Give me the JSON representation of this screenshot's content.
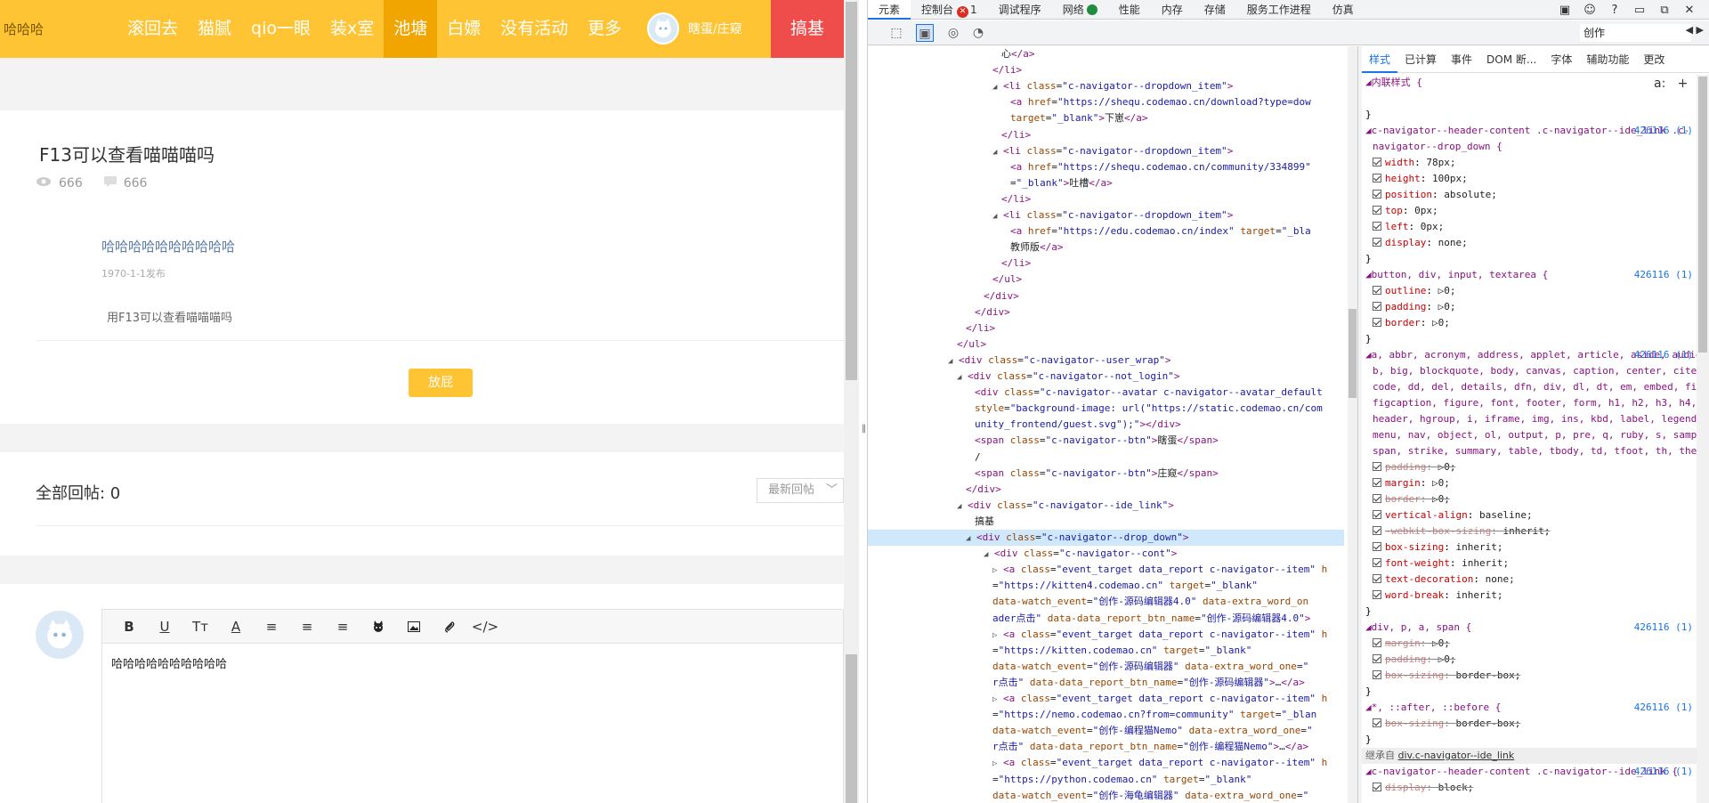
{
  "site": {
    "logo": "哈哈哈",
    "nav": [
      "滚回去",
      "猫腻",
      "qio一眼",
      "装x室",
      "池塘",
      "白嫖",
      "没有活动",
      "更多"
    ],
    "nav_active_index": 4,
    "user_text": "瞎蛋/庄窥",
    "ide_btn": "搞基",
    "accent_color": "#fec433",
    "ide_color": "#ef4c4c"
  },
  "post": {
    "title": "F13可以查看喵喵喵吗",
    "views": "666",
    "comments": "666",
    "reply_user": "哈哈哈哈哈哈哈哈哈哈",
    "reply_date": "1970-1-1发布",
    "reply_content": "用F13可以查看喵喵喵吗",
    "fart_btn": "放屁"
  },
  "replies": {
    "header": "全部回帖: 0",
    "sort": "最新回帖"
  },
  "editor": {
    "toolbar": [
      "B",
      "U",
      "Tт",
      "A",
      "≡",
      "≡",
      "≡",
      "cat",
      "image",
      "attach",
      "</>"
    ],
    "content": "哈哈哈哈哈哈哈哈哈哈"
  },
  "devtools": {
    "tabs": [
      "元素",
      "控制台",
      "调试程序",
      "网络",
      "性能",
      "内存",
      "存储",
      "服务工作进程",
      "仿真"
    ],
    "error_count": "1",
    "search_value": "创作",
    "dom_lines": [
      {
        "indent": 150,
        "html": "<span class='txt'>心</span><span class='tg'>&lt;/a&gt;</span>"
      },
      {
        "indent": 140,
        "html": "<span class='tg'>&lt;/li&gt;</span>"
      },
      {
        "indent": 140,
        "tri": "◢",
        "html": "<span class='tg'>&lt;li </span><span class='an'>class</span>=<span class='av'>\"c-navigator--dropdown_item\"</span><span class='tg'>&gt;</span>"
      },
      {
        "indent": 160,
        "html": "<span class='tg'>&lt;a </span><span class='an'>href</span>=<span class='av'>\"https://shequ.codemao.cn/download?type=dow</span>"
      },
      {
        "indent": 160,
        "html": "<span class='an'>target</span>=<span class='av'>\"_blank\"</span><span class='tg'>&gt;</span><span class='txt'>下崽</span><span class='tg'>&lt;/a&gt;</span>"
      },
      {
        "indent": 150,
        "html": "<span class='tg'>&lt;/li&gt;</span>"
      },
      {
        "indent": 140,
        "tri": "◢",
        "html": "<span class='tg'>&lt;li </span><span class='an'>class</span>=<span class='av'>\"c-navigator--dropdown_item\"</span><span class='tg'>&gt;</span>"
      },
      {
        "indent": 160,
        "html": "<span class='tg'>&lt;a </span><span class='an'>href</span>=<span class='av'>\"https://shequ.codemao.cn/community/334899\"</span>"
      },
      {
        "indent": 160,
        "html": "=<span class='av'>\"_blank\"</span><span class='tg'>&gt;</span><span class='txt'>吐槽</span><span class='tg'>&lt;/a&gt;</span>"
      },
      {
        "indent": 150,
        "html": "<span class='tg'>&lt;/li&gt;</span>"
      },
      {
        "indent": 140,
        "tri": "◢",
        "html": "<span class='tg'>&lt;li </span><span class='an'>class</span>=<span class='av'>\"c-navigator--dropdown_item\"</span><span class='tg'>&gt;</span>"
      },
      {
        "indent": 160,
        "html": "<span class='tg'>&lt;a </span><span class='an'>href</span>=<span class='av'>\"https://edu.codemao.cn/index\"</span> <span class='an'>target</span>=<span class='av'>\"_bla</span>"
      },
      {
        "indent": 160,
        "html": "<span class='txt'>教师版</span><span class='tg'>&lt;/a&gt;</span>"
      },
      {
        "indent": 150,
        "html": "<span class='tg'>&lt;/li&gt;</span>"
      },
      {
        "indent": 140,
        "html": "<span class='tg'>&lt;/ul&gt;</span>"
      },
      {
        "indent": 130,
        "html": "<span class='tg'>&lt;/div&gt;</span>"
      },
      {
        "indent": 120,
        "html": "<span class='tg'>&lt;/div&gt;</span>"
      },
      {
        "indent": 110,
        "html": "<span class='tg'>&lt;/li&gt;</span>"
      },
      {
        "indent": 100,
        "html": "<span class='tg'>&lt;/ul&gt;</span>"
      },
      {
        "indent": 90,
        "tri": "◢",
        "html": "<span class='tg'>&lt;div </span><span class='an'>class</span>=<span class='av'>\"c-navigator--user_wrap\"</span><span class='tg'>&gt;</span>"
      },
      {
        "indent": 100,
        "tri": "◢",
        "html": "<span class='tg'>&lt;div </span><span class='an'>class</span>=<span class='av'>\"c-navigator--not_login\"</span><span class='tg'>&gt;</span>"
      },
      {
        "indent": 120,
        "html": "<span class='tg'>&lt;div </span><span class='an'>class</span>=<span class='av'>\"c-navigator--avatar c-navigator--avatar_default</span>"
      },
      {
        "indent": 120,
        "html": "<span class='an'>style</span>=<span class='av'>\"background-image: url(\"https://static.codemao.cn/com</span>"
      },
      {
        "indent": 120,
        "html": "<span class='av'>unity_frontend/guest.svg\");\"</span><span class='tg'>&gt;&lt;/div&gt;</span>"
      },
      {
        "indent": 120,
        "html": "<span class='tg'>&lt;span </span><span class='an'>class</span>=<span class='av'>\"c-navigator--btn\"</span><span class='tg'>&gt;</span><span class='txt'>瞎蛋</span><span class='tg'>&lt;/span&gt;</span>"
      },
      {
        "indent": 120,
        "html": "<span class='txt'>/</span>"
      },
      {
        "indent": 120,
        "html": "<span class='tg'>&lt;span </span><span class='an'>class</span>=<span class='av'>\"c-navigator--btn\"</span><span class='tg'>&gt;</span><span class='txt'>庄窥</span><span class='tg'>&lt;/span&gt;</span>"
      },
      {
        "indent": 110,
        "html": "<span class='tg'>&lt;/div&gt;</span>"
      },
      {
        "indent": 100,
        "tri": "◢",
        "html": "<span class='tg'>&lt;div </span><span class='an'>class</span>=<span class='av'>\"c-navigator--ide_link\"</span><span class='tg'>&gt;</span>"
      },
      {
        "indent": 120,
        "html": "<span class='txt'>搞基</span>"
      },
      {
        "indent": 110,
        "tri": "◢",
        "sel": true,
        "html": "<span class='tg'>&lt;div </span><span class='an'>class</span>=<span class='av'>\"c-navigator--drop_down\"</span><span class='tg'>&gt;</span>"
      },
      {
        "indent": 130,
        "tri": "◢",
        "html": "<span class='tg'>&lt;div </span><span class='an'>class</span>=<span class='av'>\"c-navigator--cont\"</span><span class='tg'>&gt;</span>"
      },
      {
        "indent": 140,
        "tri": "▷",
        "html": "<span class='tg'>&lt;a </span><span class='an'>class</span>=<span class='av'>\"event_target data_report c-navigator--item\"</span> <span class='an'>h</span>"
      },
      {
        "indent": 140,
        "html": "=<span class='av'>\"https://kitten4.codemao.cn\"</span> <span class='an'>target</span>=<span class='av'>\"_blank\"</span>"
      },
      {
        "indent": 140,
        "html": "<span class='an'>data-watch_event</span>=<span class='av'>\"创作-源码编辑器4.0\"</span> <span class='an'>data-extra_word_on</span>"
      },
      {
        "indent": 140,
        "html": "<span class='av'>ader点击\"</span> <span class='an'>data-data_report_btn_name</span>=<span class='av'>\"创作-源码编辑器4.0\"</span><span class='tg'>&gt;</span>"
      },
      {
        "indent": 140,
        "tri": "▷",
        "html": "<span class='tg'>&lt;a </span><span class='an'>class</span>=<span class='av'>\"event_target data_report c-navigator--item\"</span> <span class='an'>h</span>"
      },
      {
        "indent": 140,
        "html": "=<span class='av'>\"https://kitten.codemao.cn\"</span> <span class='an'>target</span>=<span class='av'>\"_blank\"</span>"
      },
      {
        "indent": 140,
        "html": "<span class='an'>data-watch_event</span>=<span class='av'>\"创作-源码编辑器\"</span> <span class='an'>data-extra_word_one</span>=<span class='av'>\"</span>"
      },
      {
        "indent": 140,
        "html": "<span class='av'>r点击\"</span> <span class='an'>data-data_report_btn_name</span>=<span class='av'>\"创作-源码编辑器\"</span><span class='tg'>&gt;</span>…<span class='tg'>&lt;/a&gt;</span>"
      },
      {
        "indent": 140,
        "tri": "▷",
        "html": "<span class='tg'>&lt;a </span><span class='an'>class</span>=<span class='av'>\"event_target data_report c-navigator--item\"</span> <span class='an'>h</span>"
      },
      {
        "indent": 140,
        "html": "=<span class='av'>\"https://nemo.codemao.cn?from=community\"</span> <span class='an'>target</span>=<span class='av'>\"_blan</span>"
      },
      {
        "indent": 140,
        "html": "<span class='an'>data-watch_event</span>=<span class='av'>\"创作-编程猫Nemo\"</span> <span class='an'>data-extra_word_one</span>=<span class='av'>\"</span>"
      },
      {
        "indent": 140,
        "html": "<span class='av'>r点击\"</span> <span class='an'>data-data_report_btn_name</span>=<span class='av'>\"创作-编程猫Nemo\"</span><span class='tg'>&gt;</span>…<span class='tg'>&lt;/a&gt;</span>"
      },
      {
        "indent": 140,
        "tri": "▷",
        "html": "<span class='tg'>&lt;a </span><span class='an'>class</span>=<span class='av'>\"event_target data_report c-navigator--item\"</span> <span class='an'>h</span>"
      },
      {
        "indent": 140,
        "html": "=<span class='av'>\"https://python.codemao.cn\"</span> <span class='an'>target</span>=<span class='av'>\"_blank\"</span>"
      },
      {
        "indent": 140,
        "html": "<span class='an'>data-watch_event</span>=<span class='av'>\"创作-海龟编辑器\"</span> <span class='an'>data-extra_word_one</span>=<span class='av'>\"</span>"
      }
    ],
    "styles_tabs": [
      "样式",
      "已计算",
      "事件",
      "DOM 断...",
      "字体",
      "辅助功能",
      "更改"
    ],
    "styles": [
      {
        "type": "head",
        "text": "◢内联样式  {"
      },
      {
        "type": "blank"
      },
      {
        "type": "close"
      },
      {
        "type": "head",
        "text": "◢c-navigator--header-content .c-navigator--ide_link .c-",
        "src": "426116 (1)"
      },
      {
        "type": "headcont",
        "text": "navigator--drop_down  {"
      },
      {
        "type": "prop",
        "p": "width",
        "v": "78px;"
      },
      {
        "type": "prop",
        "p": "height",
        "v": "100px;"
      },
      {
        "type": "prop",
        "p": "position",
        "v": "absolute;"
      },
      {
        "type": "prop",
        "p": "top",
        "v": "0px;"
      },
      {
        "type": "prop",
        "p": "left",
        "v": "0px;"
      },
      {
        "type": "prop",
        "p": "display",
        "v": "none;"
      },
      {
        "type": "close"
      },
      {
        "type": "head",
        "text": "◢button, div, input, textarea  {",
        "src": "426116 (1)"
      },
      {
        "type": "prop",
        "p": "outline",
        "v": "▷0;"
      },
      {
        "type": "prop",
        "p": "padding",
        "v": "▷0;"
      },
      {
        "type": "prop",
        "p": "border",
        "v": "▷0;"
      },
      {
        "type": "close"
      },
      {
        "type": "head",
        "text": "◢a, abbr, acronym, address, applet, article, aside, audio,",
        "src": "426116 (1)"
      },
      {
        "type": "headcont",
        "text": "b, big, blockquote, body, canvas, caption, center, cite,"
      },
      {
        "type": "headcont",
        "text": "code, dd, del, details, dfn, div, dl, dt, em, embed, fieldset,"
      },
      {
        "type": "headcont",
        "text": "figcaption, figure, font, footer, form, h1, h2, h3, h4, h5, h6,"
      },
      {
        "type": "headcont",
        "text": "header, hgroup, i, iframe, img, ins, kbd, label, legend, li, mark,"
      },
      {
        "type": "headcont",
        "text": "menu, nav, object, ol, output, p, pre, q, ruby, s, samp, section,"
      },
      {
        "type": "headcont",
        "text": "span, strike, summary, table, tbody, td, tfoot, th, thead, time, tr, tt,"
      },
      {
        "type": "prop",
        "p": "padding",
        "v": "▷0;",
        "strike": true
      },
      {
        "type": "prop",
        "p": "margin",
        "v": "▷0;"
      },
      {
        "type": "prop",
        "p": "border",
        "v": "▷0;",
        "strike": true
      },
      {
        "type": "prop",
        "p": "vertical-align",
        "v": "baseline;"
      },
      {
        "type": "prop",
        "p": "-webkit-box-sizing",
        "v": "inherit;",
        "strike": true
      },
      {
        "type": "prop",
        "p": "box-sizing",
        "v": "inherit;"
      },
      {
        "type": "prop",
        "p": "font-weight",
        "v": "inherit;"
      },
      {
        "type": "prop",
        "p": "text-decoration",
        "v": "none;"
      },
      {
        "type": "prop",
        "p": "word-break",
        "v": "inherit;"
      },
      {
        "type": "close"
      },
      {
        "type": "head",
        "text": "◢div, p, a, span  {",
        "src": "426116 (1)"
      },
      {
        "type": "prop",
        "p": "margin",
        "v": "▷0;",
        "strike": true
      },
      {
        "type": "prop",
        "p": "padding",
        "v": "▷0;",
        "strike": true
      },
      {
        "type": "prop",
        "p": "box-sizing",
        "v": "border-box;",
        "strike": true
      },
      {
        "type": "close"
      },
      {
        "type": "head",
        "text": "◢*, ::after, ::before  {",
        "src": "426116 (1)"
      },
      {
        "type": "prop",
        "p": "box-sizing",
        "v": "border-box;",
        "strike": true
      },
      {
        "type": "close"
      },
      {
        "type": "inherit",
        "text": "继承自 ",
        "link": "div.c-navigator--ide_link"
      },
      {
        "type": "head",
        "text": "◢c-navigator--header-content .c-navigator--ide_link  {",
        "src": "426116 (1)"
      },
      {
        "type": "prop",
        "p": "display",
        "v": "block;",
        "strike": true
      }
    ]
  }
}
